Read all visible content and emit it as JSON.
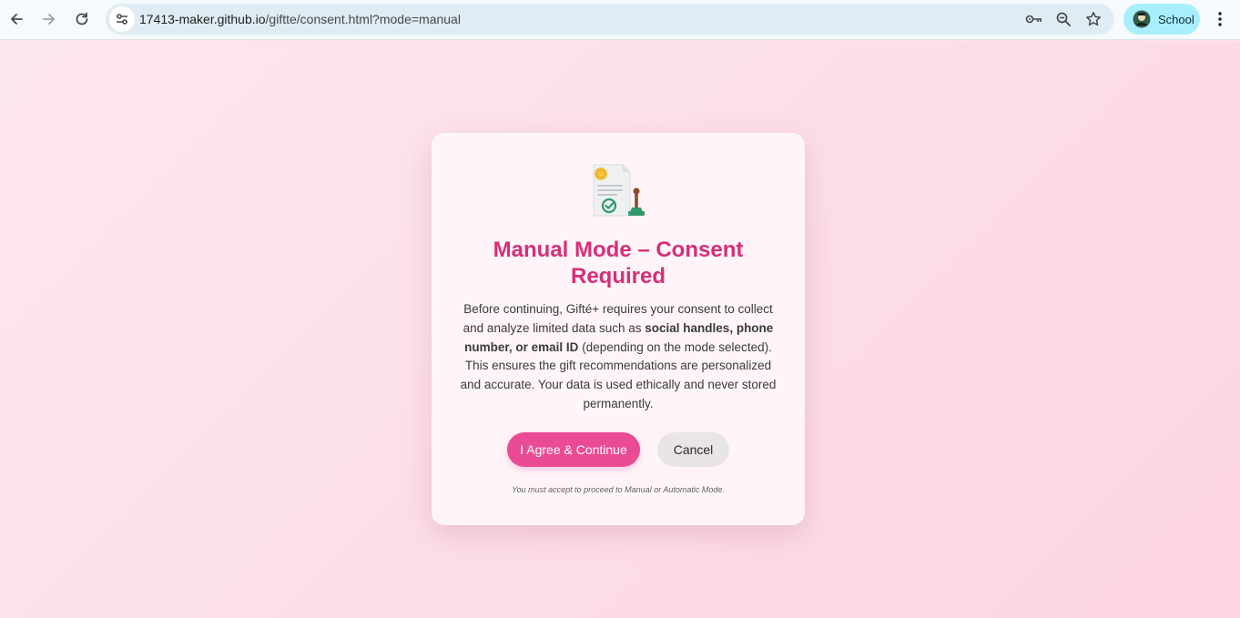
{
  "browser": {
    "url_host": "17413-maker.github.io",
    "url_path": "/giftte/consent.html?mode=manual",
    "profile_label": "School"
  },
  "consent": {
    "title": "Manual Mode – Consent Required",
    "body_part1": "Before continuing, Gifté+ requires your consent to collect and analyze limited data such as ",
    "body_bold": "social handles, phone number, or email ID",
    "body_part2": " (depending on the mode selected). This ensures the gift recommendations are personalized and accurate. Your data is used ethically and never stored permanently.",
    "agree_label": "I Agree & Continue",
    "cancel_label": "Cancel",
    "note": "You must accept to proceed to Manual or Automatic Mode."
  },
  "icons": {
    "back": "back-arrow-icon",
    "forward": "forward-arrow-icon",
    "reload": "reload-icon",
    "site_info": "site-settings-icon",
    "password": "key-icon",
    "zoom": "zoom-icon",
    "bookmark": "star-icon",
    "profile": "profile-avatar-icon",
    "menu": "kebab-menu-icon",
    "document": "consent-document-stamp-icon"
  },
  "colors": {
    "accent": "#ea4b93",
    "title": "#d62f78",
    "background": "#fde4ea",
    "card": "#fff5f8"
  }
}
